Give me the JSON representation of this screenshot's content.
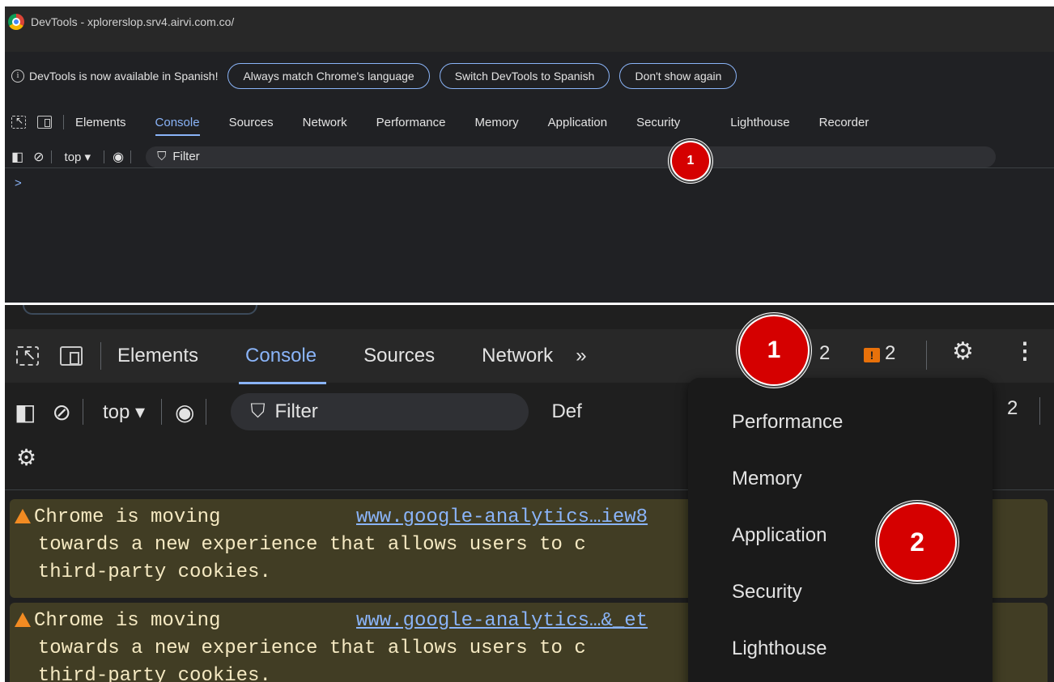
{
  "top": {
    "window_title": "DevTools - xplorerslop.srv4.airvi.com.co/",
    "infobar": {
      "icon": "info-icon",
      "text": "DevTools is now available in Spanish!",
      "buttons": [
        "Always match Chrome's language",
        "Switch DevTools to Spanish",
        "Don't show again"
      ]
    },
    "tabs": [
      "Elements",
      "Console",
      "Sources",
      "Network",
      "Performance",
      "Memory",
      "Application",
      "Security",
      "Lighthouse",
      "Recorder"
    ],
    "active_tab": "Console",
    "console_bar": {
      "context": "top ▾",
      "filter_placeholder": "Filter"
    },
    "prompt": ">",
    "badge": "1"
  },
  "bottom": {
    "tabs": [
      "Elements",
      "Console",
      "Sources",
      "Network"
    ],
    "active_tab": "Console",
    "more_tabs": "»",
    "issue_count_a": "2",
    "issue_count_b": "2",
    "console_bar": {
      "context": "top ▾",
      "filter_placeholder": "Filter",
      "levels_partial": "Def",
      "count_right": "2"
    },
    "messages": [
      {
        "lines": [
          "Chrome is moving",
          "  towards a new experience that allows users to c",
          "  third-party cookies."
        ],
        "link": "www.google-analytics…iew8"
      },
      {
        "lines": [
          "Chrome is moving",
          "  towards a new experience that allows users to c",
          "  third-party cookies."
        ],
        "link": "www.google-analytics…&_et"
      }
    ],
    "overflow_menu": [
      "Performance",
      "Memory",
      "Application",
      "Security",
      "Lighthouse"
    ],
    "badges": [
      "1",
      "2"
    ]
  },
  "colors": {
    "accent": "#8ab4f8",
    "badge": "#d50000",
    "warning_bg": "#413d24",
    "warning_icon": "#f28b22"
  }
}
